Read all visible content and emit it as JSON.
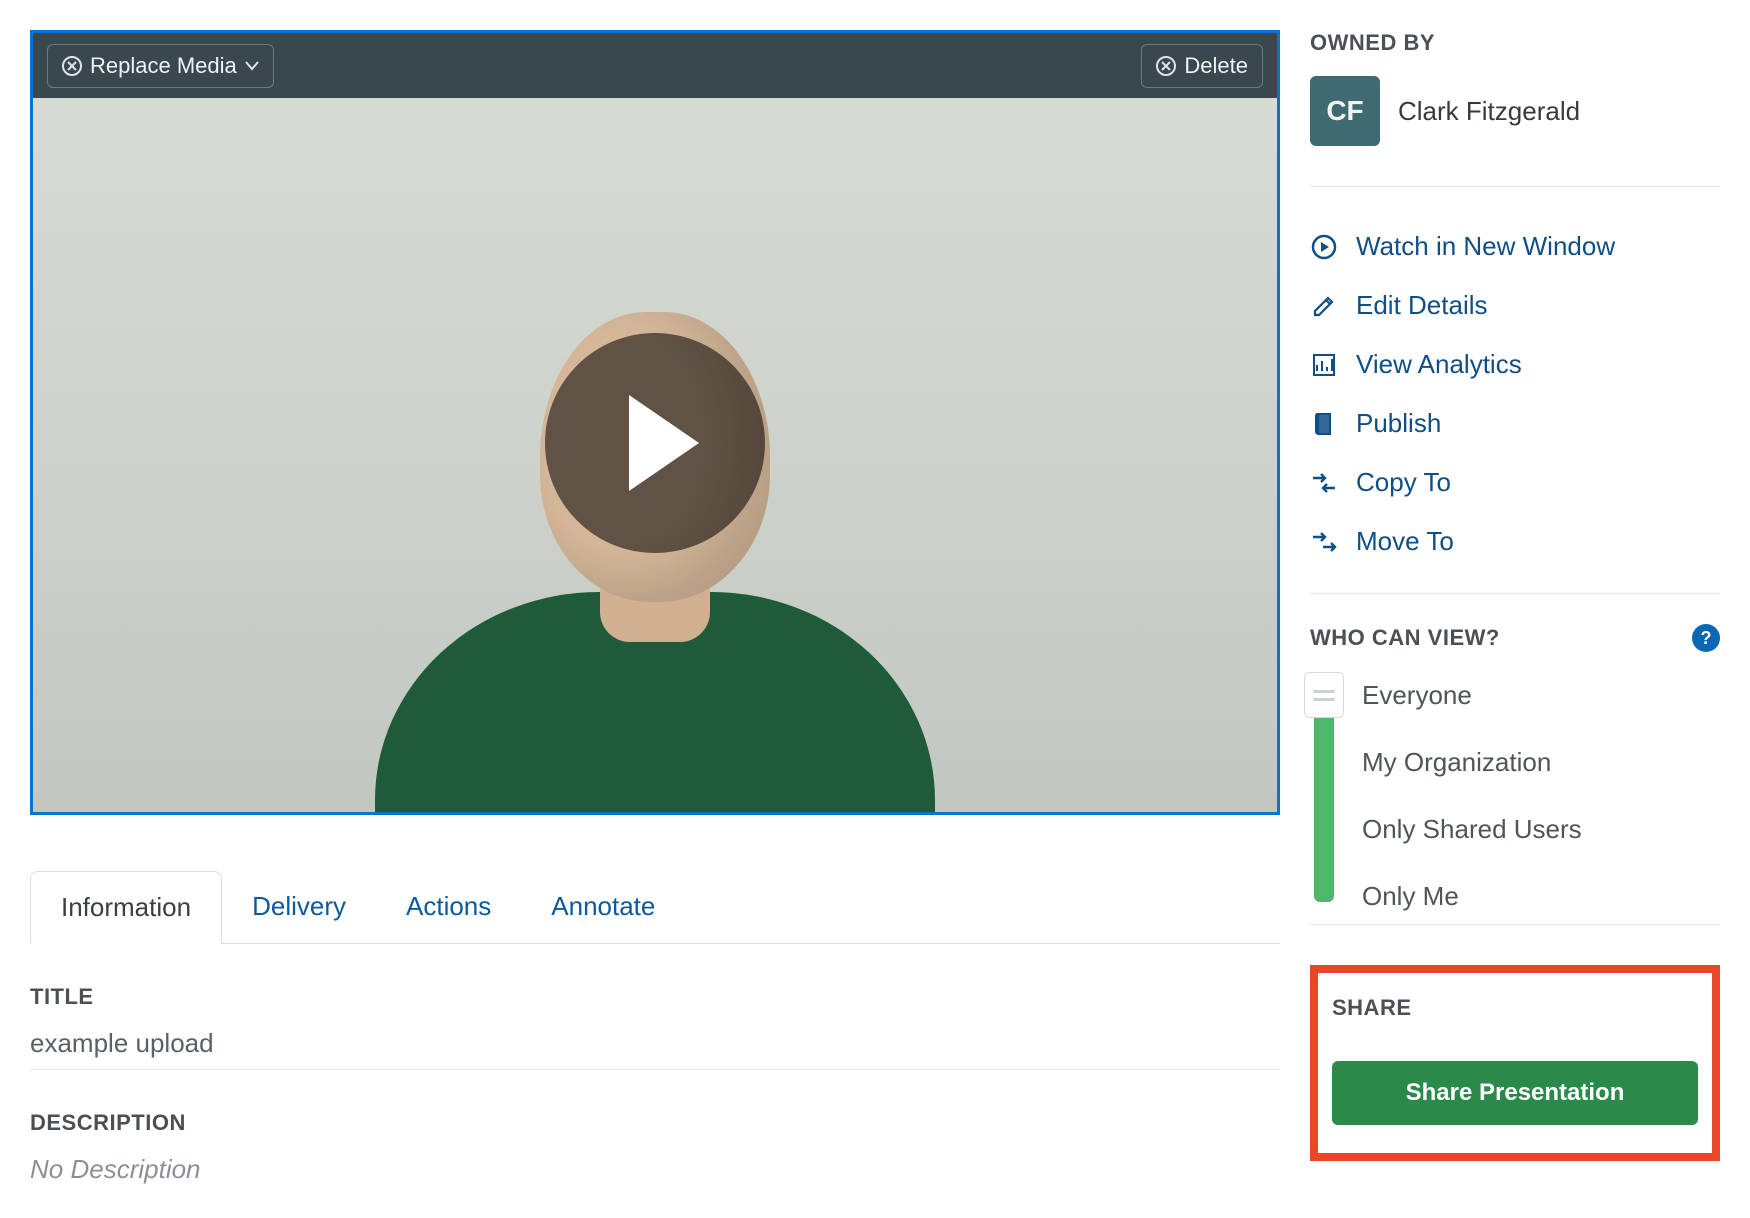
{
  "video_toolbar": {
    "replace_label": "Replace Media",
    "delete_label": "Delete"
  },
  "tabs": [
    {
      "label": "Information",
      "active": true
    },
    {
      "label": "Delivery",
      "active": false
    },
    {
      "label": "Actions",
      "active": false
    },
    {
      "label": "Annotate",
      "active": false
    }
  ],
  "info": {
    "title_label": "TITLE",
    "title_value": "example upload",
    "description_label": "DESCRIPTION",
    "description_value": "No Description"
  },
  "sidebar": {
    "owned_by_label": "OWNED BY",
    "owner_initials": "CF",
    "owner_name": "Clark Fitzgerald",
    "actions": [
      {
        "label": "Watch in New Window",
        "icon": "play-circle-icon"
      },
      {
        "label": "Edit Details",
        "icon": "edit-icon"
      },
      {
        "label": "View Analytics",
        "icon": "analytics-icon"
      },
      {
        "label": "Publish",
        "icon": "book-icon"
      },
      {
        "label": "Copy To",
        "icon": "copy-to-icon"
      },
      {
        "label": "Move To",
        "icon": "move-to-icon"
      }
    ],
    "whoview_label": "WHO CAN VIEW?",
    "view_options": [
      "Everyone",
      "My Organization",
      "Only Shared Users",
      "Only Me"
    ],
    "selected_view_index": 0,
    "share_label": "SHARE",
    "share_button": "Share Presentation"
  },
  "colors": {
    "link": "#104e86",
    "accent_green": "#2a8a4a",
    "highlight": "#e9462a"
  }
}
